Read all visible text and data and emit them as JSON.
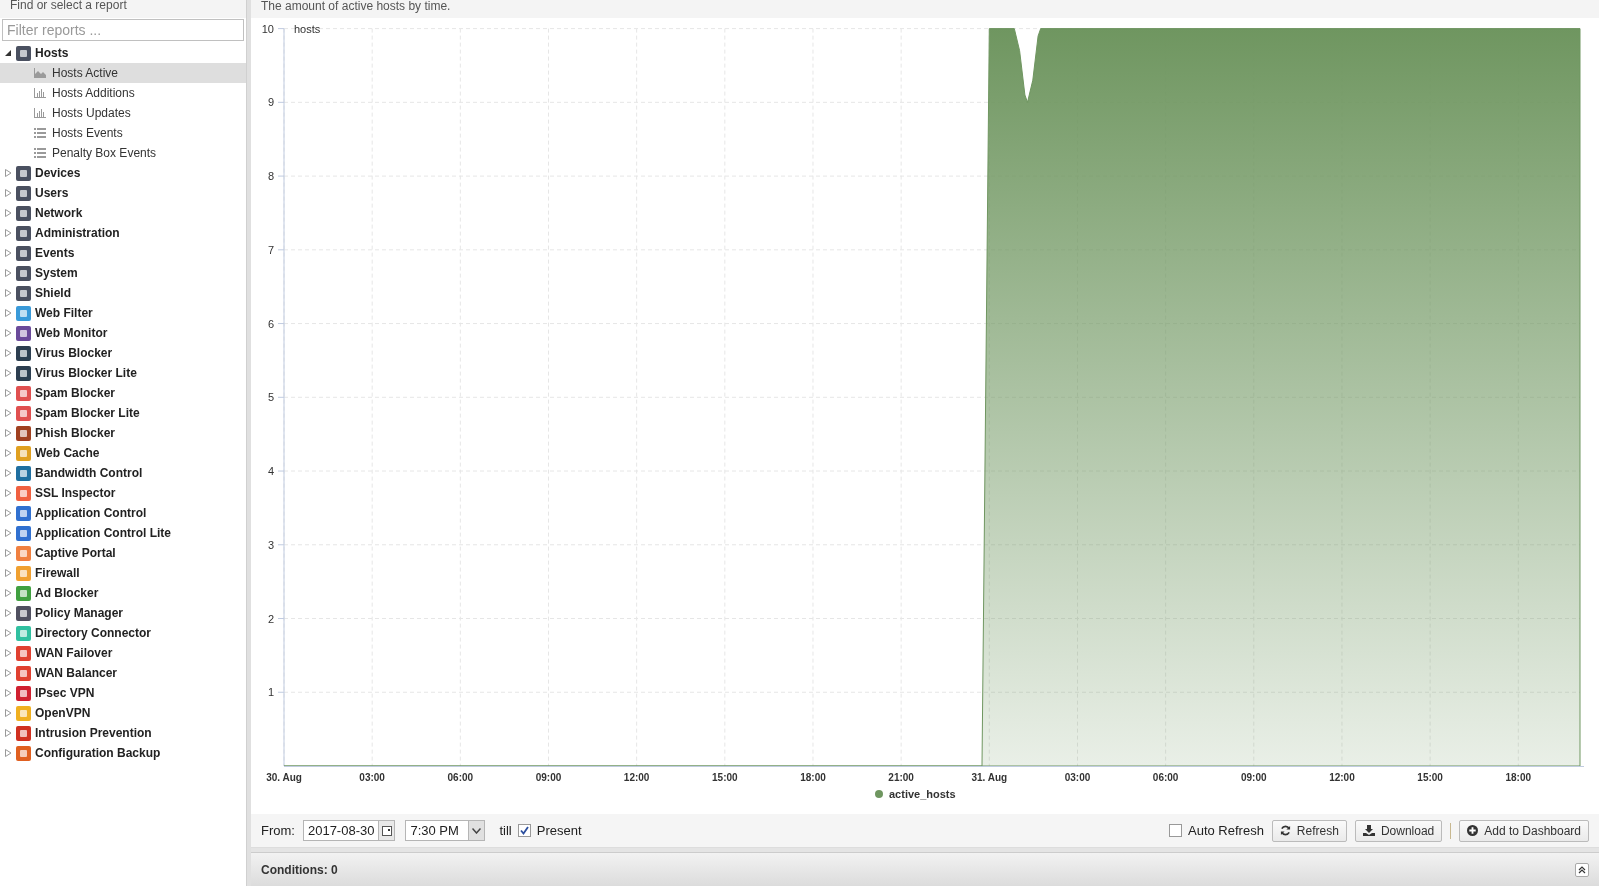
{
  "sidebar": {
    "title": "Find or select a report",
    "filter": {
      "placeholder": "Filter reports ..."
    },
    "groups": [
      {
        "label": "Hosts",
        "color": "#4a5060",
        "expanded": true,
        "children": [
          {
            "label": "Hosts Active",
            "kind": "area",
            "selected": true
          },
          {
            "label": "Hosts Additions",
            "kind": "bar",
            "selected": false
          },
          {
            "label": "Hosts Updates",
            "kind": "bar",
            "selected": false
          },
          {
            "label": "Hosts Events",
            "kind": "list",
            "selected": false
          },
          {
            "label": "Penalty Box Events",
            "kind": "list",
            "selected": false
          }
        ]
      },
      {
        "label": "Devices",
        "color": "#4a5060",
        "expanded": false
      },
      {
        "label": "Users",
        "color": "#4a5060",
        "expanded": false
      },
      {
        "label": "Network",
        "color": "#4a5060",
        "expanded": false
      },
      {
        "label": "Administration",
        "color": "#4a5060",
        "expanded": false
      },
      {
        "label": "Events",
        "color": "#4a5060",
        "expanded": false
      },
      {
        "label": "System",
        "color": "#4a5060",
        "expanded": false
      },
      {
        "label": "Shield",
        "color": "#4a5060",
        "expanded": false
      },
      {
        "label": "Web Filter",
        "color": "#3a9ad9",
        "expanded": false
      },
      {
        "label": "Web Monitor",
        "color": "#6a4a9a",
        "expanded": false
      },
      {
        "label": "Virus Blocker",
        "color": "#2c3e50",
        "expanded": false
      },
      {
        "label": "Virus Blocker Lite",
        "color": "#2c3e50",
        "expanded": false
      },
      {
        "label": "Spam Blocker",
        "color": "#e05050",
        "expanded": false
      },
      {
        "label": "Spam Blocker Lite",
        "color": "#e05050",
        "expanded": false
      },
      {
        "label": "Phish Blocker",
        "color": "#a04020",
        "expanded": false
      },
      {
        "label": "Web Cache",
        "color": "#e0a020",
        "expanded": false
      },
      {
        "label": "Bandwidth Control",
        "color": "#1f6fa0",
        "expanded": false
      },
      {
        "label": "SSL Inspector",
        "color": "#f06040",
        "expanded": false
      },
      {
        "label": "Application Control",
        "color": "#3070d0",
        "expanded": false
      },
      {
        "label": "Application Control Lite",
        "color": "#3070d0",
        "expanded": false
      },
      {
        "label": "Captive Portal",
        "color": "#f08040",
        "expanded": false
      },
      {
        "label": "Firewall",
        "color": "#f0a030",
        "expanded": false
      },
      {
        "label": "Ad Blocker",
        "color": "#40a040",
        "expanded": false
      },
      {
        "label": "Policy Manager",
        "color": "#505060",
        "expanded": false
      },
      {
        "label": "Directory Connector",
        "color": "#30c0a0",
        "expanded": false
      },
      {
        "label": "WAN Failover",
        "color": "#e04030",
        "expanded": false
      },
      {
        "label": "WAN Balancer",
        "color": "#e04030",
        "expanded": false
      },
      {
        "label": "IPsec VPN",
        "color": "#d02030",
        "expanded": false
      },
      {
        "label": "OpenVPN",
        "color": "#f0b020",
        "expanded": false
      },
      {
        "label": "Intrusion Prevention",
        "color": "#d03020",
        "expanded": false
      },
      {
        "label": "Configuration Backup",
        "color": "#e06020",
        "expanded": false
      }
    ]
  },
  "report": {
    "description": "The amount of active hosts by time.",
    "chart_data": {
      "type": "area",
      "ylabel": "hosts",
      "grid": true,
      "xlim": [
        "2017-08-30T00:00",
        "2017-08-31T20:06"
      ],
      "ylim": [
        0,
        10
      ],
      "x": [
        "2017-08-30T00:00",
        "2017-08-30T23:45",
        "2017-08-31T00:00",
        "2017-08-31T00:51",
        "2017-08-31T01:18",
        "2017-08-31T01:45",
        "2017-08-31T20:06"
      ],
      "series": [
        {
          "name": "active_hosts",
          "color": "#6f9660",
          "values": [
            0,
            0,
            10,
            10,
            9,
            10,
            10
          ]
        }
      ],
      "xticks": [
        {
          "value": "2017-08-30T00:00",
          "label": "30. Aug"
        },
        {
          "value": "2017-08-30T03:00",
          "label": "03:00"
        },
        {
          "value": "2017-08-30T06:00",
          "label": "06:00"
        },
        {
          "value": "2017-08-30T09:00",
          "label": "09:00"
        },
        {
          "value": "2017-08-30T12:00",
          "label": "12:00"
        },
        {
          "value": "2017-08-30T15:00",
          "label": "15:00"
        },
        {
          "value": "2017-08-30T18:00",
          "label": "18:00"
        },
        {
          "value": "2017-08-30T21:00",
          "label": "21:00"
        },
        {
          "value": "2017-08-31T00:00",
          "label": "31. Aug"
        },
        {
          "value": "2017-08-31T03:00",
          "label": "03:00"
        },
        {
          "value": "2017-08-31T06:00",
          "label": "06:00"
        },
        {
          "value": "2017-08-31T09:00",
          "label": "09:00"
        },
        {
          "value": "2017-08-31T12:00",
          "label": "12:00"
        },
        {
          "value": "2017-08-31T15:00",
          "label": "15:00"
        },
        {
          "value": "2017-08-31T18:00",
          "label": "18:00"
        }
      ],
      "yticks": [
        1,
        2,
        3,
        4,
        5,
        6,
        7,
        8,
        9,
        10
      ]
    }
  },
  "toolbar": {
    "from_label": "From:",
    "date": "2017-08-30",
    "time": "7:30 PM",
    "till_label": "till",
    "present": {
      "label": "Present",
      "checked": true
    },
    "auto_refresh": {
      "label": "Auto Refresh",
      "checked": false
    },
    "buttons": [
      {
        "label": "Refresh",
        "kind": "refresh"
      },
      {
        "label": "Download",
        "kind": "download"
      },
      {
        "label": "Add to Dashboard",
        "kind": "add"
      }
    ]
  },
  "conditions": {
    "label": "Conditions: 0"
  }
}
